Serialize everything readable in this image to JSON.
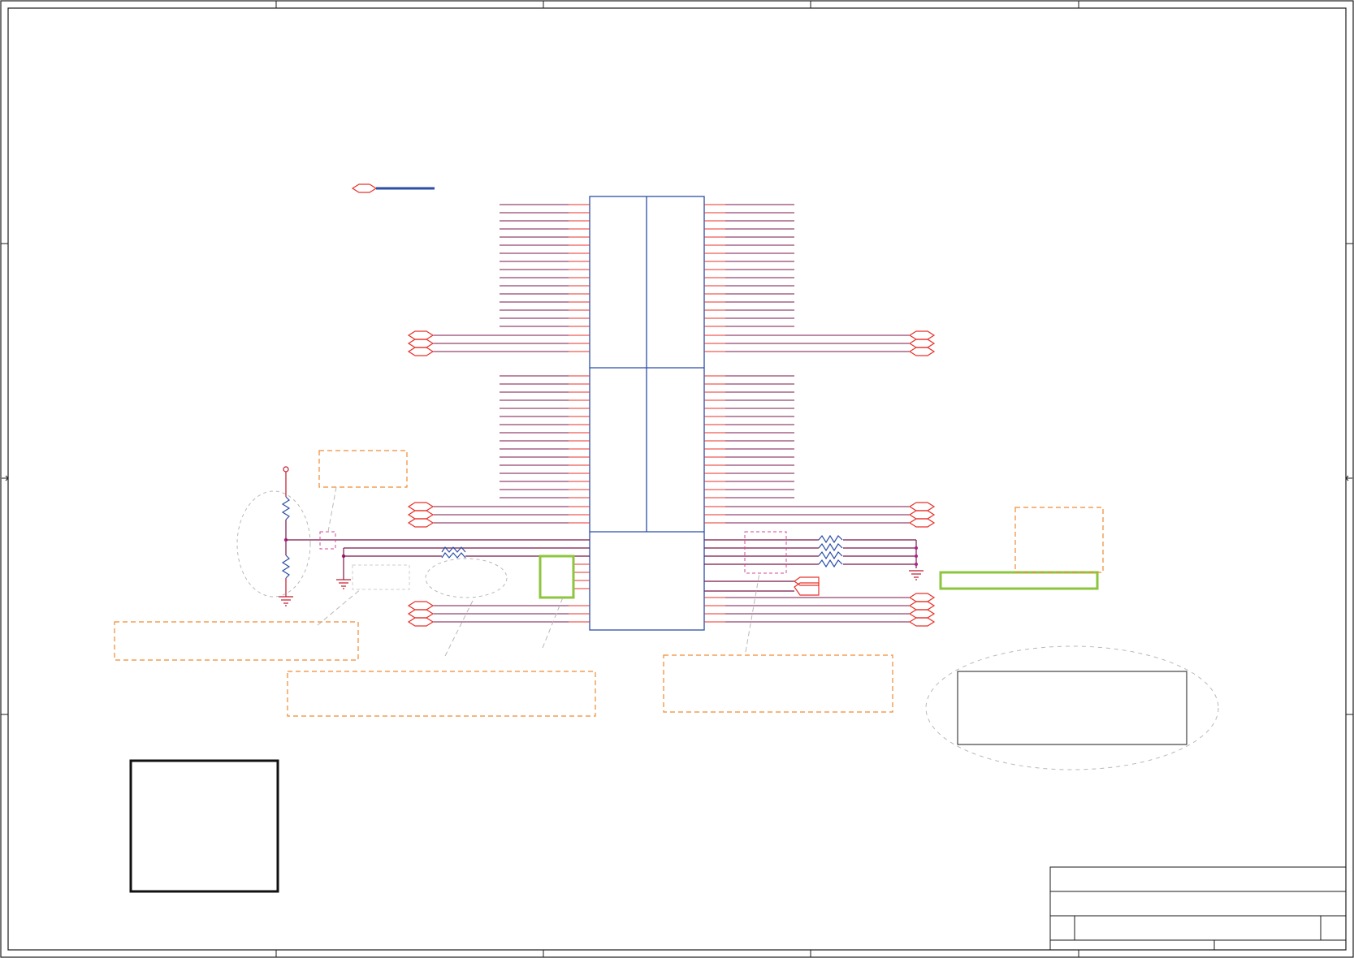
{
  "sheet": {
    "title_block_text": [],
    "zone_labels": []
  },
  "colors": {
    "frame": "#1a1a1a",
    "pin": "#e8312a",
    "pin_tip": "#f0a0a0",
    "net": "#7a1648",
    "component": "#2b4ea8",
    "port": "#e8312a",
    "note_box": "#f08a30",
    "highlight": "#8cc63f",
    "ellipse": "#b8b8b8",
    "junction": "#b0208a",
    "ground": "#c0192a",
    "resistor": "#2b4ea8"
  },
  "icons": {
    "off_page_connector": "hexagon-port-icon",
    "ground": "ground-icon",
    "resistor": "resistor-icon",
    "power_pin": "power-pin-icon"
  }
}
